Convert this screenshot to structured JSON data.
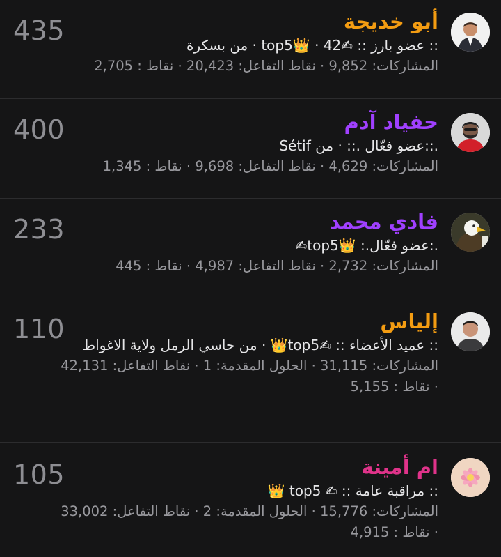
{
  "members": [
    {
      "name": "أبو خديجة",
      "name_color": "#f39c12",
      "score": "435",
      "title_line": ":: عضو بارز :: ✍top5👑 · 42 · من بسكرة",
      "stats_line1": "المشاركات: 9,852 · نقاط التفاعل: 20,423 · نقاط : 2,705",
      "stats_line2": "",
      "avatar": "man-in-suit-avatar"
    },
    {
      "name": "حفياد آدم",
      "name_color": "#a040ff",
      "score": "400",
      "title_line": ".::عضو فعّال .:: · من Sétif",
      "stats_line1": "المشاركات: 4,629 · نقاط التفاعل: 9,698 · نقاط : 1,345",
      "stats_line2": "",
      "avatar": "bearded-man-avatar"
    },
    {
      "name": "فادي محمد",
      "name_color": "#a040ff",
      "score": "233",
      "title_line": ".:عضو فعّال.: 👑top5✍",
      "stats_line1": "المشاركات: 2,732 · نقاط التفاعل: 4,987 · نقاط : 445",
      "stats_line2": "",
      "avatar": "eagle-avatar"
    },
    {
      "name": "إلياس",
      "name_color": "#f39c12",
      "score": "110",
      "title_line": ":: عميد الأعضاء :: ✍top5👑 · من حاسي الرمل ولاية الاغواط",
      "stats_line1": "المشاركات: 31,115 · الحلول المقدمة: 1 · نقاط التفاعل: 42,131",
      "stats_line2": "· نقاط : 5,155",
      "avatar": "man-portrait-avatar"
    },
    {
      "name": "ام أمينة",
      "name_color": "#e0338a",
      "score": "105",
      "title_line": ":: مراقبة عامة :: ✍ top5 👑",
      "stats_line1": "المشاركات: 15,776 · الحلول المقدمة: 2 · نقاط التفاعل: 33,002",
      "stats_line2": "· نقاط : 4,915",
      "avatar": "flower-avatar"
    }
  ]
}
